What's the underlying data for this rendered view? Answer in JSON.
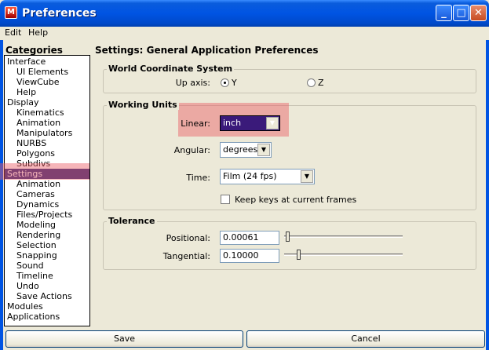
{
  "window": {
    "title": "Preferences",
    "icon": "maya-app-icon",
    "controls": {
      "minimize": "_",
      "maximize": "□",
      "close": "✕"
    }
  },
  "menu": [
    "Edit",
    "Help"
  ],
  "categories": {
    "heading": "Categories",
    "items": [
      {
        "label": "Interface",
        "level": 0,
        "selected": false
      },
      {
        "label": "UI Elements",
        "level": 1,
        "selected": false
      },
      {
        "label": "ViewCube",
        "level": 1,
        "selected": false
      },
      {
        "label": "Help",
        "level": 1,
        "selected": false
      },
      {
        "label": "Display",
        "level": 0,
        "selected": false
      },
      {
        "label": "Kinematics",
        "level": 1,
        "selected": false
      },
      {
        "label": "Animation",
        "level": 1,
        "selected": false
      },
      {
        "label": "Manipulators",
        "level": 1,
        "selected": false
      },
      {
        "label": "NURBS",
        "level": 1,
        "selected": false
      },
      {
        "label": "Polygons",
        "level": 1,
        "selected": false
      },
      {
        "label": "Subdivs",
        "level": 1,
        "selected": false
      },
      {
        "label": "Settings",
        "level": 0,
        "selected": true
      },
      {
        "label": "Animation",
        "level": 1,
        "selected": false
      },
      {
        "label": "Cameras",
        "level": 1,
        "selected": false
      },
      {
        "label": "Dynamics",
        "level": 1,
        "selected": false
      },
      {
        "label": "Files/Projects",
        "level": 1,
        "selected": false
      },
      {
        "label": "Modeling",
        "level": 1,
        "selected": false
      },
      {
        "label": "Rendering",
        "level": 1,
        "selected": false
      },
      {
        "label": "Selection",
        "level": 1,
        "selected": false
      },
      {
        "label": "Snapping",
        "level": 1,
        "selected": false
      },
      {
        "label": "Sound",
        "level": 1,
        "selected": false
      },
      {
        "label": "Timeline",
        "level": 1,
        "selected": false
      },
      {
        "label": "Undo",
        "level": 1,
        "selected": false
      },
      {
        "label": "Save Actions",
        "level": 1,
        "selected": false
      },
      {
        "label": "Modules",
        "level": 0,
        "selected": false
      },
      {
        "label": "Applications",
        "level": 0,
        "selected": false
      }
    ]
  },
  "settings": {
    "title": "Settings: General Application Preferences",
    "world": {
      "label": "World Coordinate System",
      "up_axis_label": "Up axis:",
      "options": [
        {
          "label": "Y",
          "selected": true
        },
        {
          "label": "Z",
          "selected": false
        }
      ]
    },
    "units": {
      "label": "Working Units",
      "linear_label": "Linear:",
      "linear_value": "inch",
      "angular_label": "Angular:",
      "angular_value": "degrees",
      "time_label": "Time:",
      "time_value": "Film (24 fps)",
      "keep_keys_label": "Keep keys at current frames",
      "keep_keys_checked": false,
      "dropdown_arrow": "▼"
    },
    "tolerance": {
      "label": "Tolerance",
      "positional_label": "Positional:",
      "positional_value": "0.00061",
      "positional_level": 0.0,
      "tangential_label": "Tangential:",
      "tangential_value": "0.10000",
      "tangential_level": 0.1
    }
  },
  "buttons": {
    "save": "Save",
    "cancel": "Cancel"
  },
  "colors": {
    "titlebar": "#0054e3",
    "selection": "#2a2a7a",
    "highlight": "#eb5a64"
  }
}
